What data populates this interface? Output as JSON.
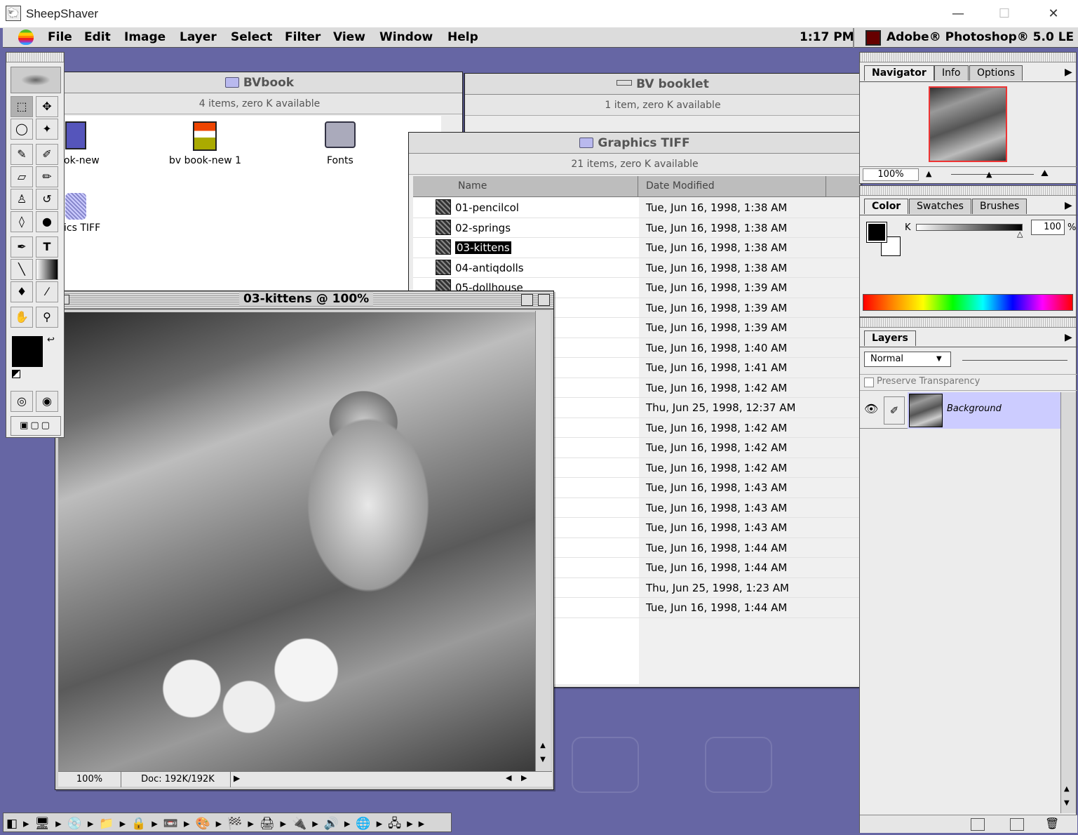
{
  "host": {
    "title": "SheepShaver",
    "min": "—",
    "max": "☐",
    "close": "✕"
  },
  "menubar": {
    "items": [
      "File",
      "Edit",
      "Image",
      "Layer",
      "Select",
      "Filter",
      "View",
      "Window",
      "Help"
    ],
    "clock": "1:17 PM",
    "app": "Adobe® Photoshop® 5.0 LE"
  },
  "bvbook": {
    "title": "BVbook",
    "info": "4 items, zero K available",
    "icons": [
      {
        "label": "ok-new"
      },
      {
        "label": "bv book-new 1"
      },
      {
        "label": "Fonts"
      },
      {
        "label": "ics TIFF"
      }
    ]
  },
  "booklet": {
    "title": "BV booklet",
    "info": "1 item, zero K available"
  },
  "graphics": {
    "title": "Graphics TIFF",
    "info": "21 items, zero K available",
    "col_name": "Name",
    "col_date": "Date Modified",
    "rows": [
      {
        "name": "01-pencilcol",
        "date": "Tue, Jun 16, 1998, 1:38 AM"
      },
      {
        "name": "02-springs",
        "date": "Tue, Jun 16, 1998, 1:38 AM"
      },
      {
        "name": "03-kittens",
        "date": "Tue, Jun 16, 1998, 1:38 AM"
      },
      {
        "name": "04-antiqdolls",
        "date": "Tue, Jun 16, 1998, 1:38 AM"
      },
      {
        "name": "05-dollhouse",
        "date": "Tue, Jun 16, 1998, 1:39 AM"
      },
      {
        "name": "",
        "date": "Tue, Jun 16, 1998, 1:39 AM"
      },
      {
        "name": "",
        "date": "Tue, Jun 16, 1998, 1:39 AM"
      },
      {
        "name": "",
        "date": "Tue, Jun 16, 1998, 1:40 AM"
      },
      {
        "name": "",
        "date": "Tue, Jun 16, 1998, 1:41 AM"
      },
      {
        "name": "",
        "date": "Tue, Jun 16, 1998, 1:42 AM"
      },
      {
        "name": "",
        "date": "Thu, Jun 25, 1998, 12:37 AM"
      },
      {
        "name": "",
        "date": "Tue, Jun 16, 1998, 1:42 AM"
      },
      {
        "name": "",
        "date": "Tue, Jun 16, 1998, 1:42 AM"
      },
      {
        "name": "",
        "date": "Tue, Jun 16, 1998, 1:42 AM"
      },
      {
        "name": "",
        "date": "Tue, Jun 16, 1998, 1:43 AM"
      },
      {
        "name": "",
        "date": "Tue, Jun 16, 1998, 1:43 AM"
      },
      {
        "name": "",
        "date": "Tue, Jun 16, 1998, 1:43 AM"
      },
      {
        "name": "",
        "date": "Tue, Jun 16, 1998, 1:44 AM"
      },
      {
        "name": "",
        "date": "Tue, Jun 16, 1998, 1:44 AM"
      },
      {
        "name": "",
        "date": "Thu, Jun 25, 1998, 1:23 AM"
      },
      {
        "name": "",
        "date": "Tue, Jun 16, 1998, 1:44 AM"
      }
    ]
  },
  "docwin": {
    "title": "03-kittens @ 100%",
    "zoom": "100%",
    "doc": "Doc: 192K/192K"
  },
  "navigator": {
    "tabs": [
      "Navigator",
      "Info",
      "Options"
    ],
    "zoom": "100%"
  },
  "color": {
    "tabs": [
      "Color",
      "Swatches",
      "Brushes"
    ],
    "channel": "K",
    "value": "100",
    "unit": "%"
  },
  "layers": {
    "tabs": [
      "Layers"
    ],
    "mode": "Normal",
    "preserve": "Preserve Transparency",
    "layer_name": "Background"
  },
  "colors": {
    "desktop": "#6666a4",
    "selection": "#ccccff",
    "nav_frame": "#e33"
  }
}
